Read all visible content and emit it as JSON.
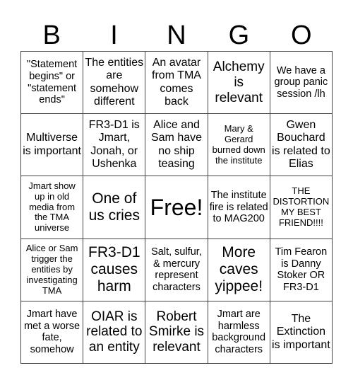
{
  "header": {
    "letters": [
      "B",
      "I",
      "N",
      "G",
      "O"
    ]
  },
  "cells": [
    "\"Statement begins\" or \"statement ends\"",
    "The entities are somehow different",
    "An avatar from TMA comes back",
    "Alchemy is relevant",
    "We have a group panic session /lh",
    "Multiverse is important",
    "FR3-D1 is Jmart, Jonah, or Ushenka",
    "Alice and Sam have no ship teasing",
    "Mary & Gerard burned down the institute",
    "Gwen Bouchard is related to Elias",
    "Jmart show up in old media from the TMA universe",
    "One of us cries",
    "Free!",
    "The institute fire is related to MAG200",
    "THE DISTORTION MY BEST FRIEND!!!!",
    "Alice or Sam trigger the entities by investigating TMA",
    "FR3-D1 causes harm",
    "Salt, sulfur, & mercury represent characters",
    "More caves yippee!",
    "Tim Fearon is Danny Stoker OR FR3-D1",
    "Jmart have met a worse fate, somehow",
    "OIAR is related to an entity",
    "Robert Smirke is relevant",
    "Jmart are harmless background characters",
    "The Extinction is important"
  ]
}
